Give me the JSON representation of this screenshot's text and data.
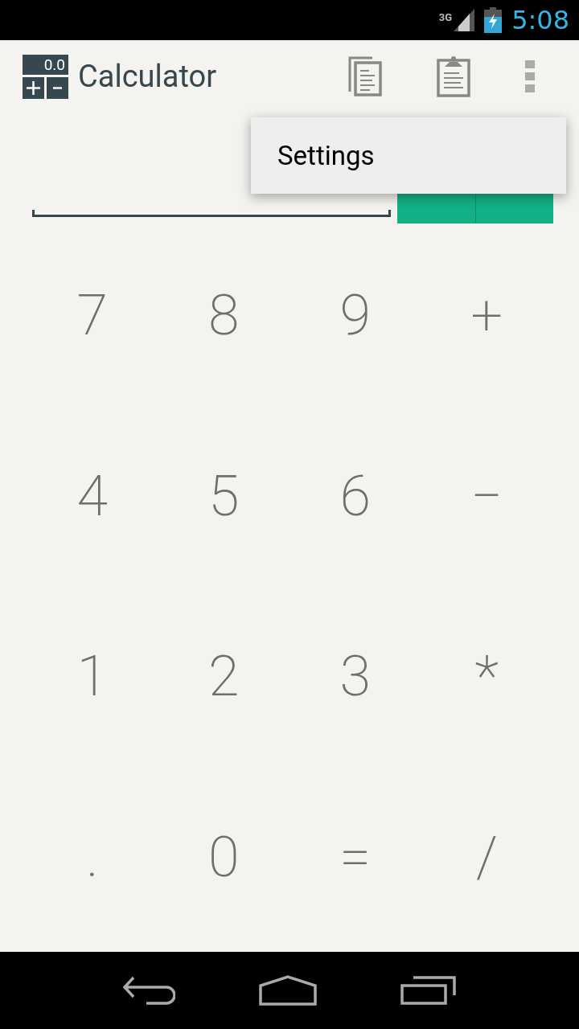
{
  "status_bar": {
    "network": "3G",
    "time": "5:08"
  },
  "app_bar": {
    "logo_display": "0.0",
    "title": "Calculator"
  },
  "menu": {
    "items": [
      "Settings"
    ]
  },
  "keypad": [
    [
      "7",
      "8",
      "9",
      "+"
    ],
    [
      "4",
      "5",
      "6",
      "−"
    ],
    [
      "1",
      "2",
      "3",
      "*"
    ],
    [
      ".",
      "0",
      "=",
      "/"
    ]
  ]
}
